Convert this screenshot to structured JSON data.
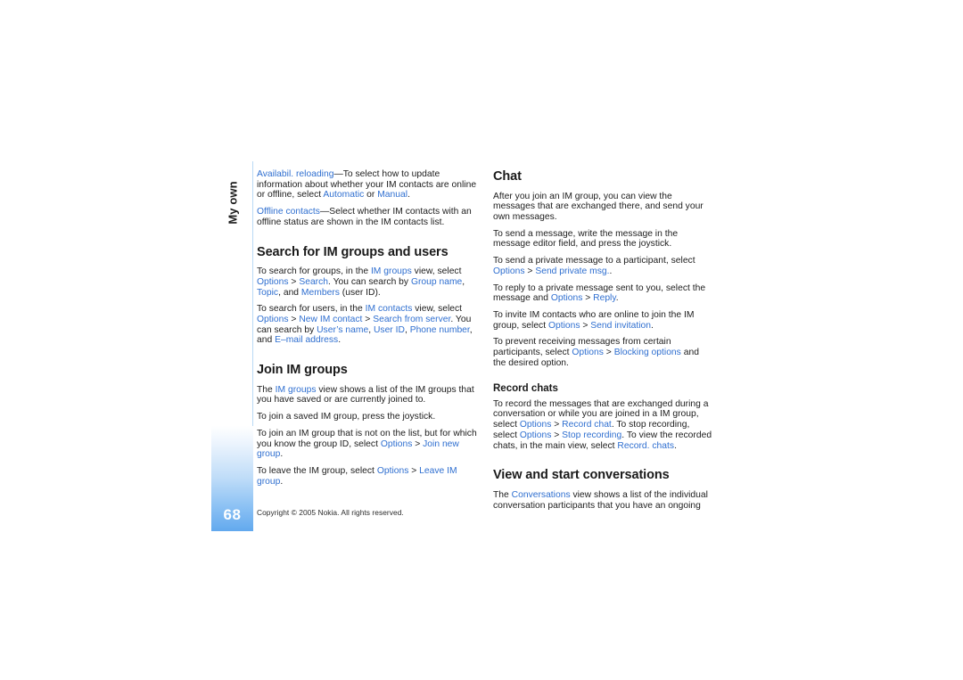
{
  "document": {
    "chapter_label": "My own",
    "page_number": "68",
    "footer": "Copyright © 2005 Nokia. All rights reserved.",
    "accent_color": "#2f6fd0",
    "tab_gradient_end": "#62a9ee"
  },
  "left_column": {
    "para_availability": {
      "term": "Availabil. reloading",
      "text_1": "—To select how to update information about whether your IM contacts are online or offline, select ",
      "option_1": "Automatic",
      "text_2": " or ",
      "option_2": "Manual",
      "text_3": "."
    },
    "para_offline": {
      "term": "Offline contacts",
      "text_1": "—Select whether IM contacts with an offline status are shown in the IM contacts list."
    },
    "heading_search": "Search for IM groups and users",
    "para_search_groups": {
      "t1": "To search for groups, in the ",
      "k1": "IM groups",
      "t2": " view, select ",
      "k2": "Options",
      "sep1": " > ",
      "k3": "Search",
      "t3": ". You can search by ",
      "k4": "Group name",
      "t4": ", ",
      "k5": "Topic",
      "t5": ", and ",
      "k6": "Members",
      "t6": " (user ID)."
    },
    "para_search_users": {
      "t1": "To search for users, in the ",
      "k1": "IM contacts",
      "t2": " view, select ",
      "k2": "Options",
      "sep1": " > ",
      "k3": "New IM contact",
      "sep2": " > ",
      "k4": "Search from server",
      "t3": ". You can search by ",
      "k5": "User’s name",
      "t4": ", ",
      "k6": "User ID",
      "t5": ", ",
      "k7": "Phone number",
      "t6": ", and ",
      "k8": "E–mail address",
      "t7": "."
    },
    "heading_join": "Join IM groups",
    "para_join_view": {
      "t1": "The ",
      "k1": "IM groups",
      "t2": " view shows a list of the IM groups that you have saved or are currently joined to."
    },
    "para_join_saved": {
      "t1": "To join a saved IM group, press the joystick."
    },
    "para_join_new": {
      "t1": "To join an IM group that is not on the list, but for which you know the group ID, select ",
      "k1": "Options",
      "sep1": " > ",
      "k2": "Join new group",
      "t2": "."
    },
    "para_leave": {
      "t1": "To leave the IM group, select ",
      "k1": "Options",
      "sep1": " > ",
      "k2": "Leave IM group",
      "t2": "."
    }
  },
  "right_column": {
    "heading_chat": "Chat",
    "para_chat_intro": {
      "t1": "After you join an IM group, you can view the messages that are exchanged there, and send your own messages."
    },
    "para_send_message": {
      "t1": "To send a message, write the message in the message editor field, and press the joystick."
    },
    "para_private_message": {
      "t1": "To send a private message to a participant, select ",
      "k1": "Options",
      "sep1": " > ",
      "k2": "Send private msg.",
      "t2": "."
    },
    "para_reply": {
      "t1": "To reply to a private message sent to you, select the message and ",
      "k1": "Options",
      "sep1": " > ",
      "k2": "Reply",
      "t2": "."
    },
    "para_invite": {
      "t1": "To invite IM contacts who are online to join the IM group, select ",
      "k1": "Options",
      "sep1": " > ",
      "k2": "Send invitation",
      "t2": "."
    },
    "para_blocking": {
      "t1": "To prevent receiving messages from certain participants, select ",
      "k1": "Options",
      "sep1": " > ",
      "k2": "Blocking options",
      "t2": " and the desired option."
    },
    "subheading_record": "Record chats",
    "para_record": {
      "t1": "To record the messages that are exchanged during a conversation or while you are joined in a IM group, select ",
      "k1": "Options",
      "sep1": " > ",
      "k2": "Record chat",
      "t2": ". To stop recording, select ",
      "k3": "Options",
      "sep2": " > ",
      "k4": "Stop recording",
      "t3": ". To view the recorded chats, in the main view, select ",
      "k5": "Record. chats",
      "t4": "."
    },
    "heading_conversations": "View and start conversations",
    "para_conversations": {
      "t1": "The ",
      "k1": "Conversations",
      "t2": " view shows a list of the individual conversation participants that you have an ongoing"
    }
  }
}
